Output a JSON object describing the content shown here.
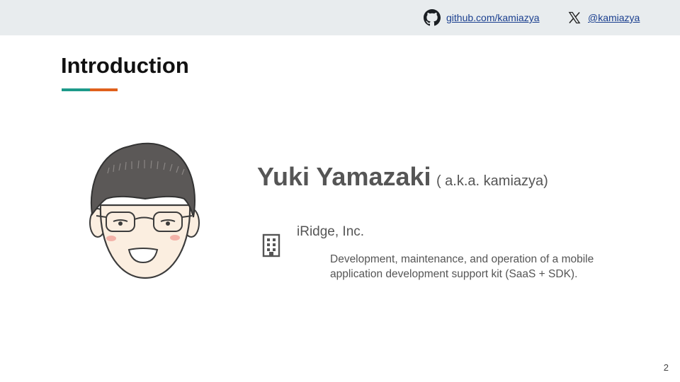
{
  "header": {
    "github": {
      "text": "github.com/kamiazya",
      "icon": "github-icon"
    },
    "x": {
      "text": "@kamiazya",
      "icon": "x-logo-icon"
    }
  },
  "slide": {
    "title": "Introduction",
    "accent_colors": [
      "#1d9a8a",
      "#e0601c"
    ],
    "name": "Yuki Yamazaki",
    "aka": "( a.k.a. kamiazya)",
    "company": {
      "icon": "building-icon",
      "name": "iRidge, Inc.",
      "description": "Development, maintenance, and operation of a mobile application development support kit (SaaS + SDK)."
    },
    "avatar_icon": "avatar-illustration"
  },
  "footer": {
    "page_number": "2"
  }
}
